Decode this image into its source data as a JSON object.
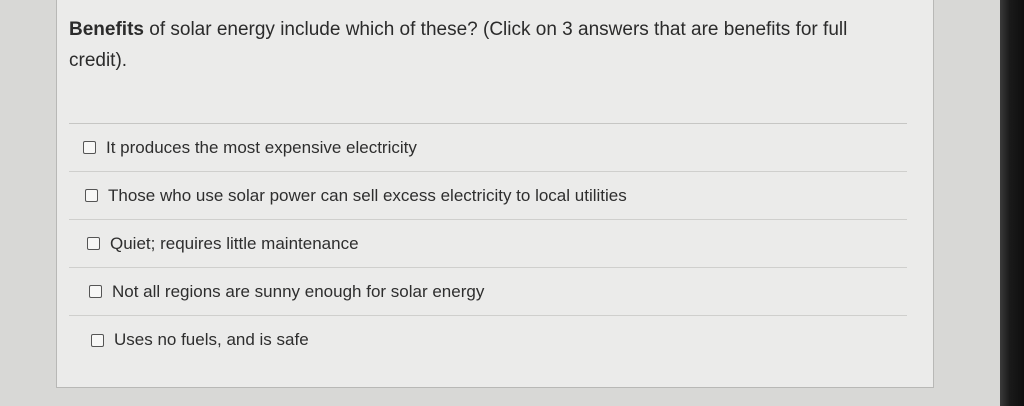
{
  "question": {
    "bold_prefix": "Benefits",
    "text": " of solar energy include which of these? (Click on 3 answers that are benefits for full credit)."
  },
  "options": [
    {
      "label": "It produces the most expensive electricity",
      "checked": false
    },
    {
      "label": "Those who use solar power can sell excess electricity to local utilities",
      "checked": false
    },
    {
      "label": "Quiet; requires little maintenance",
      "checked": false
    },
    {
      "label": "Not all regions are sunny enough for solar energy",
      "checked": false
    },
    {
      "label": "Uses no fuels, and is safe",
      "checked": false
    }
  ]
}
